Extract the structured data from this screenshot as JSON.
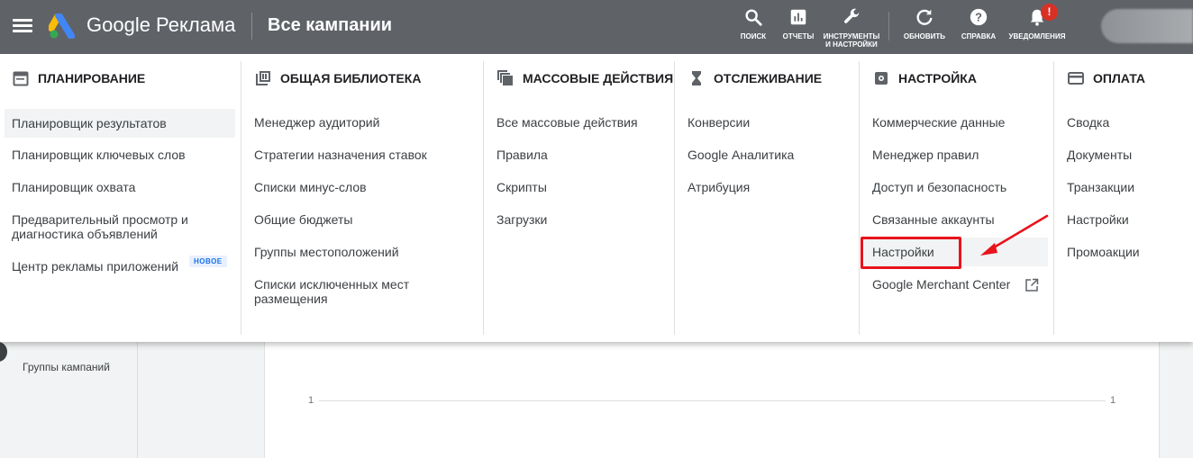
{
  "header": {
    "brand": "Google Реклама",
    "title": "Все кампании",
    "actions": [
      {
        "label": "ПОИСК",
        "icon": "search-icon"
      },
      {
        "label": "ОТЧЕТЫ",
        "icon": "reports-icon"
      },
      {
        "label": "ИНСТРУМЕНТЫ И НАСТРОЙКИ",
        "icon": "wrench-icon"
      },
      {
        "label": "ОБНОВИТЬ",
        "icon": "refresh-icon"
      },
      {
        "label": "СПРАВКА",
        "icon": "help-icon"
      },
      {
        "label": "УВЕДОМЛЕНИЯ",
        "icon": "bell-icon"
      }
    ],
    "notification_badge": "!"
  },
  "menu": {
    "planning": {
      "title": "ПЛАНИРОВАНИЕ",
      "items": [
        "Планировщик результатов",
        "Планировщик ключевых слов",
        "Планировщик охвата",
        "Предварительный просмотр и диагностика объявлений",
        "Центр рекламы приложений"
      ],
      "new_badge": "НОВОЕ"
    },
    "library": {
      "title": "ОБЩАЯ БИБЛИОТЕКА",
      "items": [
        "Менеджер аудиторий",
        "Стратегии назначения ставок",
        "Списки минус-слов",
        "Общие бюджеты",
        "Группы местоположений",
        "Списки исключенных мест размещения"
      ]
    },
    "bulk": {
      "title": "МАССОВЫЕ ДЕЙСТВИЯ",
      "items": [
        "Все массовые действия",
        "Правила",
        "Скрипты",
        "Загрузки"
      ]
    },
    "tracking": {
      "title": "ОТСЛЕЖИВАНИЕ",
      "items": [
        "Конверсии",
        "Google Аналитика",
        "Атрибуция"
      ]
    },
    "setup": {
      "title": "НАСТРОЙКА",
      "items": [
        "Коммерческие данные",
        "Менеджер правил",
        "Доступ и безопасность",
        "Связанные аккаунты",
        "Настройки",
        "Google Merchant Center"
      ]
    },
    "billing": {
      "title": "ОПЛАТА",
      "items": [
        "Сводка",
        "Документы",
        "Транзакции",
        "Настройки",
        "Промоакции"
      ]
    }
  },
  "page": {
    "left_nav_item": "Группы кампаний",
    "chart_tick_left": "1",
    "chart_tick_right": "1"
  },
  "colors": {
    "topbar": "#5f6368",
    "highlight_box": "#e8131c",
    "new_badge": "#1a73e8"
  }
}
